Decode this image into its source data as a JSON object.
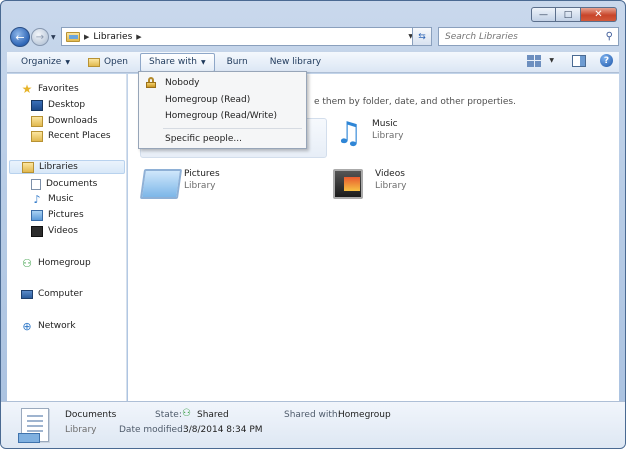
{
  "window": {
    "caption_min": "—",
    "caption_max": "□",
    "caption_close": "✕"
  },
  "nav": {
    "back": "←",
    "forward": "→",
    "address_root": "Libraries",
    "search_placeholder": "Search Libraries"
  },
  "toolbar": {
    "organize": "Organize",
    "open": "Open",
    "share_with": "Share with",
    "burn": "Burn",
    "new_library": "New library"
  },
  "share_menu": {
    "items": [
      "Nobody",
      "Homegroup (Read)",
      "Homegroup (Read/Write)",
      "Specific people..."
    ]
  },
  "sidebar": {
    "favorites": "Favorites",
    "favorites_items": [
      "Desktop",
      "Downloads",
      "Recent Places"
    ],
    "libraries": "Libraries",
    "libraries_items": [
      "Documents",
      "Music",
      "Pictures",
      "Videos"
    ],
    "homegroup": "Homegroup",
    "computer": "Computer",
    "network": "Network"
  },
  "content": {
    "hint": "e them by folder, date, and other properties.",
    "tiles": [
      {
        "name": "Music",
        "type": "Library"
      },
      {
        "name": "Pictures",
        "type": "Library"
      },
      {
        "name": "Videos",
        "type": "Library"
      }
    ]
  },
  "details": {
    "name": "Documents",
    "type": "Library",
    "state_label": "State:",
    "state_value": "Shared",
    "shared_with_label": "Shared with:",
    "shared_with_value": "Homegroup",
    "modified_label": "Date modified:",
    "modified_value": "3/8/2014 8:34 PM"
  }
}
